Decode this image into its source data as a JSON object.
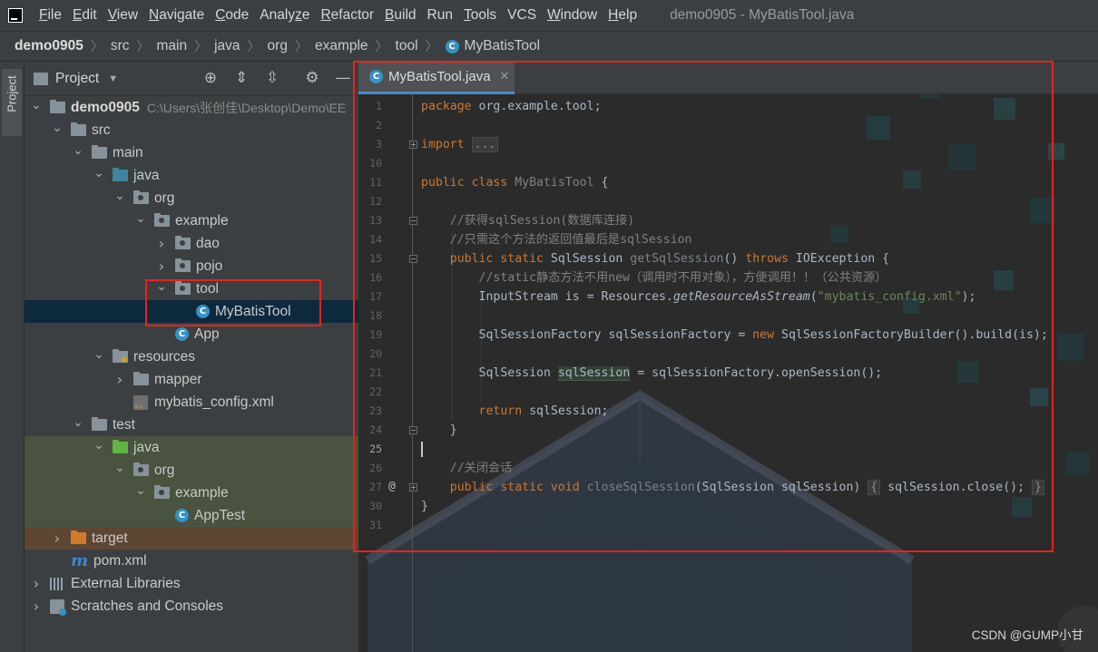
{
  "menubar": {
    "items": [
      {
        "mn": "F",
        "rest": "ile"
      },
      {
        "mn": "E",
        "rest": "dit"
      },
      {
        "mn": "V",
        "rest": "iew"
      },
      {
        "mn": "N",
        "rest": "avigate"
      },
      {
        "mn": "C",
        "rest": "ode"
      },
      {
        "mn": "",
        "rest": "Analyze",
        "mnu": "z"
      },
      {
        "mn": "R",
        "rest": "efactor"
      },
      {
        "mn": "B",
        "rest": "uild"
      },
      {
        "mn": "",
        "rest": "Run"
      },
      {
        "mn": "T",
        "rest": "ools"
      },
      {
        "mn": "",
        "rest": "VCS"
      },
      {
        "mn": "W",
        "rest": "indow"
      },
      {
        "mn": "H",
        "rest": "elp"
      }
    ],
    "window_title": "demo0905 - MyBatisTool.java"
  },
  "breadcrumbs": [
    "demo0905",
    "src",
    "main",
    "java",
    "org",
    "example",
    "tool",
    "MyBatisTool"
  ],
  "toolstrip": {
    "project_tab": "Project"
  },
  "project_panel": {
    "title": "Project",
    "tree": [
      {
        "label": "demo0905",
        "extra": "C:\\Users\\张创佳\\Desktop\\Demo\\EE",
        "indent": 0,
        "arrow": "down",
        "icon": "module"
      },
      {
        "label": "src",
        "indent": 1,
        "arrow": "down",
        "icon": "folder"
      },
      {
        "label": "main",
        "indent": 2,
        "arrow": "down",
        "icon": "folder"
      },
      {
        "label": "java",
        "indent": 3,
        "arrow": "down",
        "icon": "folder-blue"
      },
      {
        "label": "org",
        "indent": 4,
        "arrow": "down",
        "icon": "package"
      },
      {
        "label": "example",
        "indent": 5,
        "arrow": "down",
        "icon": "package"
      },
      {
        "label": "dao",
        "indent": 6,
        "arrow": "right",
        "icon": "package"
      },
      {
        "label": "pojo",
        "indent": 6,
        "arrow": "right",
        "icon": "package"
      },
      {
        "label": "tool",
        "indent": 6,
        "arrow": "down",
        "icon": "package"
      },
      {
        "label": "MyBatisTool",
        "indent": 7,
        "arrow": "none",
        "icon": "class",
        "selected": true
      },
      {
        "label": "App",
        "indent": 6,
        "arrow": "none",
        "icon": "class"
      },
      {
        "label": "resources",
        "indent": 3,
        "arrow": "down",
        "icon": "resources"
      },
      {
        "label": "mapper",
        "indent": 4,
        "arrow": "right",
        "icon": "folder"
      },
      {
        "label": "mybatis_config.xml",
        "indent": 4,
        "arrow": "none",
        "icon": "xml"
      },
      {
        "label": "test",
        "indent": 2,
        "arrow": "down",
        "icon": "folder"
      },
      {
        "label": "java",
        "indent": 3,
        "arrow": "down",
        "icon": "folder-green",
        "test": true
      },
      {
        "label": "org",
        "indent": 4,
        "arrow": "down",
        "icon": "package",
        "test": true
      },
      {
        "label": "example",
        "indent": 5,
        "arrow": "down",
        "icon": "package",
        "test": true
      },
      {
        "label": "AppTest",
        "indent": 6,
        "arrow": "none",
        "icon": "class",
        "test": true
      },
      {
        "label": "target",
        "indent": 1,
        "arrow": "right",
        "icon": "folder-orange",
        "excluded": true
      },
      {
        "label": "pom.xml",
        "indent": 1,
        "arrow": "none",
        "icon": "maven"
      },
      {
        "label": "External Libraries",
        "indent": 0,
        "arrow": "right",
        "icon": "library"
      },
      {
        "label": "Scratches and Consoles",
        "indent": 0,
        "arrow": "right",
        "icon": "scratch"
      }
    ]
  },
  "editor": {
    "tab_label": "MyBatisTool.java",
    "tab_icon_letter": "C",
    "line_numbers": [
      "1",
      "2",
      "3",
      "10",
      "11",
      "12",
      "13",
      "14",
      "15",
      "16",
      "17",
      "18",
      "19",
      "20",
      "21",
      "22",
      "23",
      "24",
      "25",
      "26",
      "27",
      "30",
      "31"
    ],
    "current_line": "25",
    "code_tokens": [
      [
        {
          "t": "package ",
          "c": "kw"
        },
        {
          "t": "org.example.tool;"
        }
      ],
      [],
      [
        {
          "t": "import ",
          "c": "kw"
        },
        {
          "t": "...",
          "c": "folded"
        }
      ],
      [],
      [
        {
          "t": "public class ",
          "c": "kw"
        },
        {
          "t": "MyBatisTool",
          "c": "unused"
        },
        {
          "t": " {"
        }
      ],
      [],
      [
        {
          "t": "    //获得sqlSession(数据库连接)",
          "c": "cm"
        }
      ],
      [
        {
          "t": "    //只需这个方法的返回值最后是sqlSession",
          "c": "cm"
        }
      ],
      [
        {
          "t": "    "
        },
        {
          "t": "public static ",
          "c": "kw"
        },
        {
          "t": "SqlSession "
        },
        {
          "t": "getSqlSession",
          "c": "unused"
        },
        {
          "t": "() "
        },
        {
          "t": "throws ",
          "c": "kw"
        },
        {
          "t": "IOException {"
        }
      ],
      [
        {
          "t": "        //static静态方法不用new（调用时不用对象），方便调用！！（公共资源）",
          "c": "cm"
        }
      ],
      [
        {
          "t": "        InputStream is = Resources."
        },
        {
          "t": "getResourceAsStream",
          "c": "static-call"
        },
        {
          "t": "("
        },
        {
          "t": "\"mybatis_config.xml\"",
          "c": "str"
        },
        {
          "t": ");"
        }
      ],
      [],
      [
        {
          "t": "        SqlSessionFactory sqlSessionFactory = "
        },
        {
          "t": "new ",
          "c": "kw"
        },
        {
          "t": "SqlSessionFactoryBuilder().build(is);"
        }
      ],
      [],
      [
        {
          "t": "        SqlSession "
        },
        {
          "t": "sqlSession",
          "c": "hl-var"
        },
        {
          "t": " = sqlSessionFactory.openSession();"
        }
      ],
      [],
      [
        {
          "t": "        "
        },
        {
          "t": "return ",
          "c": "kw"
        },
        {
          "t": "sqlSession;"
        }
      ],
      [
        {
          "t": "    }"
        }
      ],
      [],
      [
        {
          "t": "    //关闭会话",
          "c": "cm"
        }
      ],
      [
        {
          "t": "    "
        },
        {
          "t": "public static void ",
          "c": "kw"
        },
        {
          "t": "closeSqlSession",
          "c": "unused"
        },
        {
          "t": "(SqlSession sqlSession) "
        },
        {
          "t": "{",
          "c": "folded"
        },
        {
          "t": " sqlSession.close(); "
        },
        {
          "t": "}",
          "c": "folded"
        }
      ],
      [
        {
          "t": "}"
        }
      ],
      []
    ]
  },
  "watermark": "CSDN @GUMP小甘"
}
